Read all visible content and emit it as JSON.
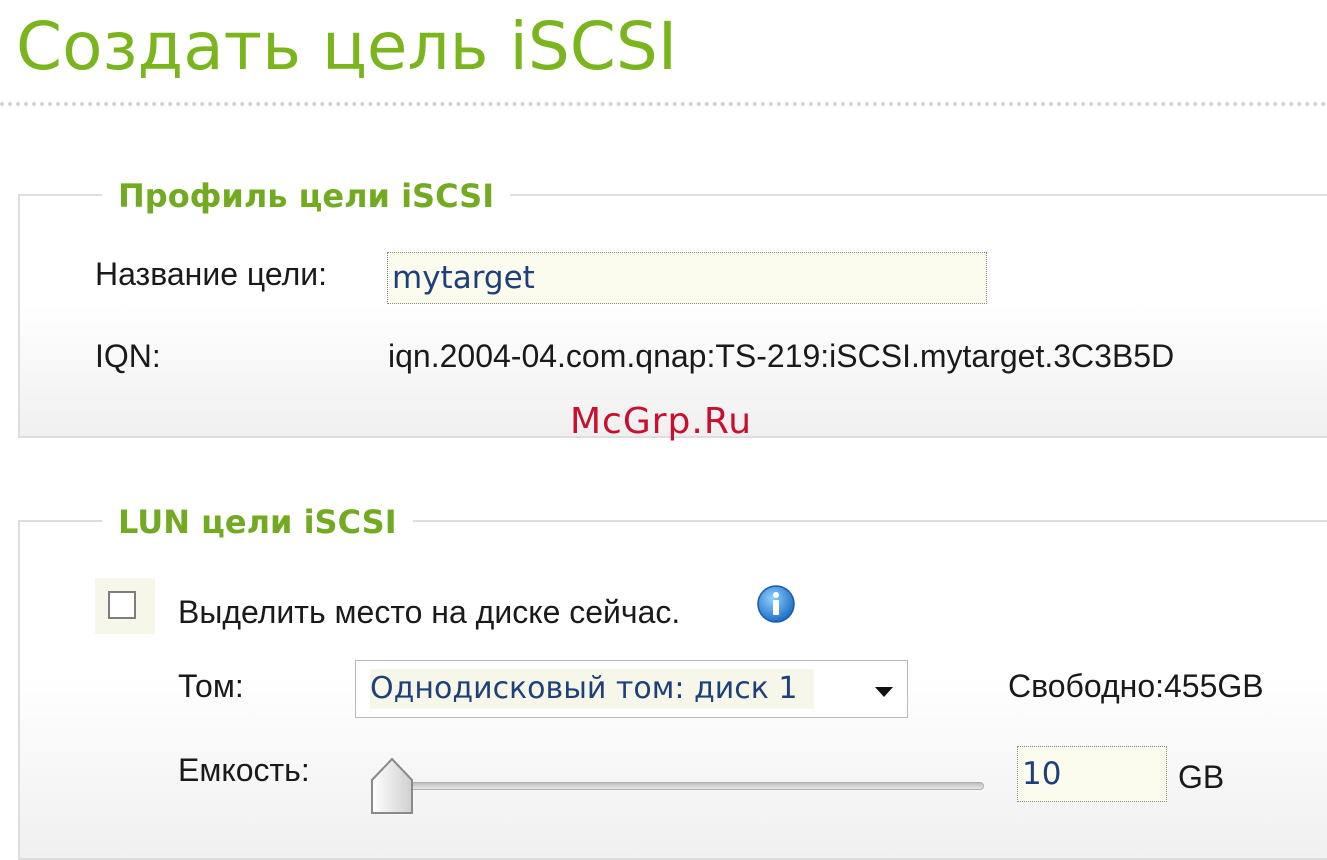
{
  "page": {
    "title": "Создать цель iSCSI"
  },
  "profile": {
    "legend": "Профиль цели iSCSI",
    "target_name_label": "Название цели:",
    "target_name_value": "mytarget",
    "iqn_label": "IQN:",
    "iqn_value": "iqn.2004-04.com.qnap:TS-219:iSCSI.mytarget.3C3B5D"
  },
  "watermark": "McGrp.Ru",
  "lun": {
    "legend": "LUN цели iSCSI",
    "allocate_checkbox_label": "Выделить место на диске сейчас.",
    "allocate_checked": false,
    "info_icon": "info-icon",
    "volume_label": "Том:",
    "volume_selected": "Однодисковый том: диск 1",
    "free_label": "Свободно:455GB",
    "capacity_label": "Емкость:",
    "capacity_value": "10",
    "capacity_unit": "GB",
    "capacity_slider_fraction": 0.0
  },
  "colors": {
    "title_green": "#7ab51d",
    "legend_green": "#72aa22",
    "input_text_blue": "#1d3f7a",
    "info_blue": "#1f7ad6",
    "watermark_red": "#c8102e"
  }
}
